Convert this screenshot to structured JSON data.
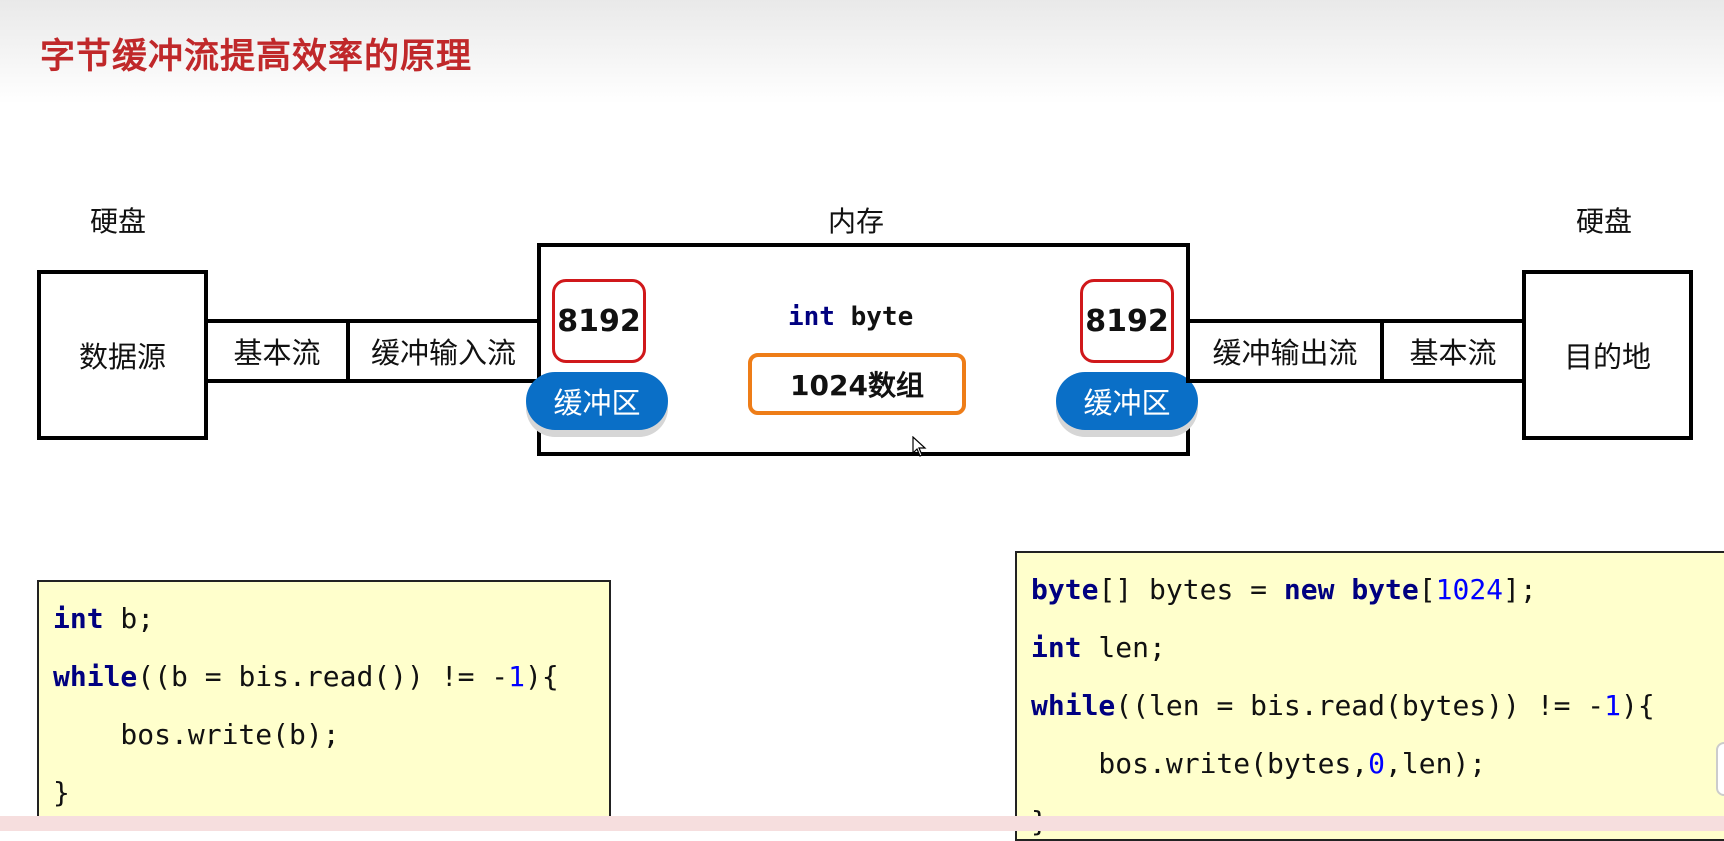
{
  "title": "字节缓冲流提高效率的原理",
  "labels": {
    "disk_left": "硬盘",
    "memory": "内存",
    "disk_right": "硬盘"
  },
  "left_side": {
    "source": "数据源",
    "basic_stream": "基本流",
    "buffered_input": "缓冲输入流"
  },
  "memory_box": {
    "left_buffer_size": "8192",
    "left_buffer_label": "缓冲区",
    "int_keyword": "int",
    "byte_text": " byte",
    "array_label": "1024数组",
    "right_buffer_size": "8192",
    "right_buffer_label": "缓冲区"
  },
  "right_side": {
    "buffered_output": "缓冲输出流",
    "basic_stream": "基本流",
    "destination": "目的地"
  },
  "code_left": {
    "line1_kw": "int",
    "line1_rest": " b;",
    "line2_kw": "while",
    "line2_rest_a": "((b = bis.read()) != -",
    "line2_num": "1",
    "line2_rest_b": "){",
    "line3": "    bos.write(b);",
    "line4": "}"
  },
  "code_right": {
    "line1_kw1": "byte",
    "line1_mid": "[] bytes = ",
    "line1_kw2": "new",
    "line1_sp": " ",
    "line1_kw3": "byte",
    "line1_b1": "[",
    "line1_num": "1024",
    "line1_end": "];",
    "line2_kw": "int",
    "line2_rest": " len;",
    "line3_kw": "while",
    "line3_rest_a": "((len = bis.read(bytes)) != -",
    "line3_num": "1",
    "line3_rest_b": "){",
    "line4_a": "    bos.write(bytes,",
    "line4_num": "0",
    "line4_b": ",len);",
    "line5": "}"
  },
  "colors": {
    "title": "#c0282a",
    "buffer_pill": "#0a6fc7",
    "size_border": "#d0181b",
    "array_border": "#ee7d18",
    "code_bg": "#ffffcc",
    "keyword": "#000080",
    "number": "#0000ff"
  }
}
